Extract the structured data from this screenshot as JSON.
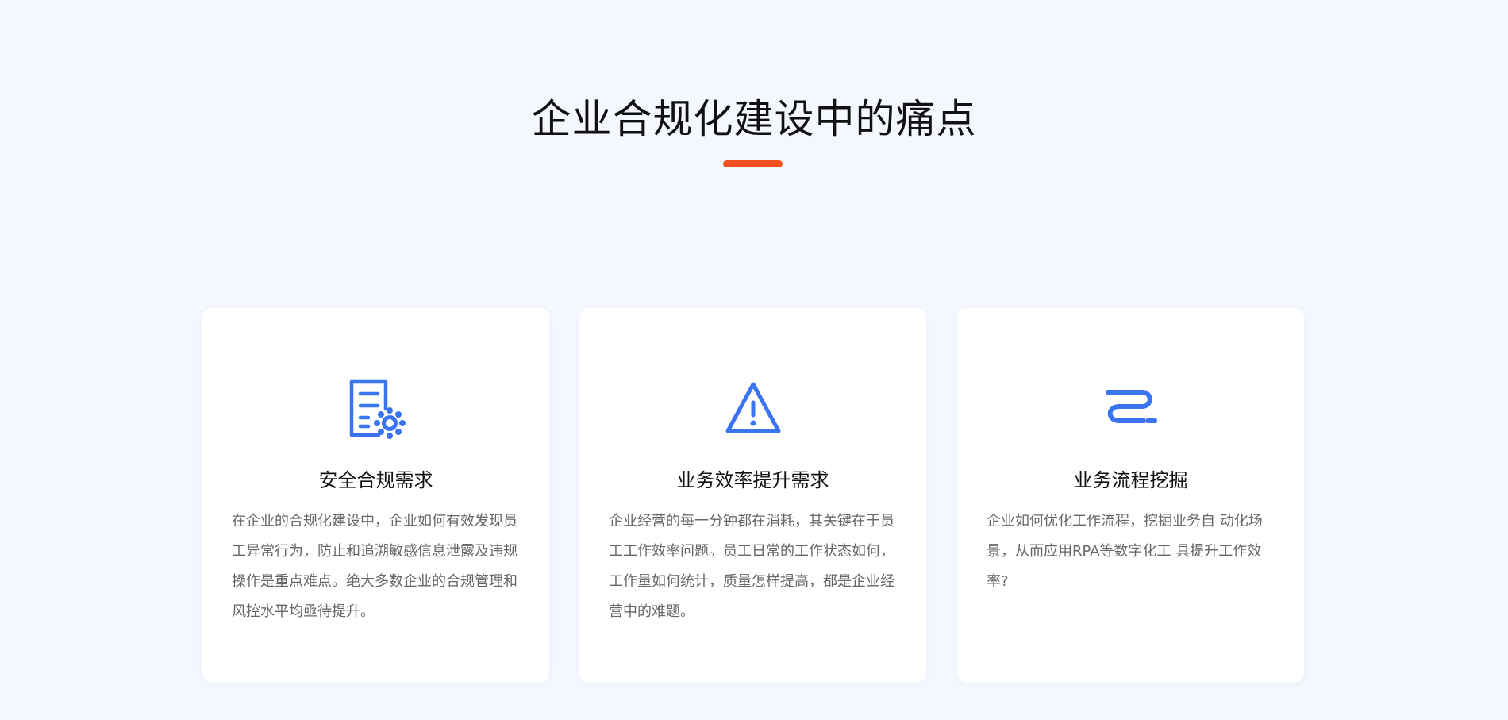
{
  "section": {
    "title": "企业合规化建设中的痛点",
    "accent_color": "#f0521f",
    "icon_color": "#3b74f0"
  },
  "cards": [
    {
      "icon": "document-settings-icon",
      "title": "安全合规需求",
      "description": "在企业的合规化建设中，企业如何有效发现员工异常行为，防止和追溯敏感信息泄露及违规操作是重点难点。绝大多数企业的合规管理和风控水平均亟待提升。"
    },
    {
      "icon": "warning-icon",
      "title": "业务效率提升需求",
      "description": "企业经营的每一分钟都在消耗，其关键在于员工工作效率问题。员工日常的工作状态如何，工作量如何统计，质量怎样提高，都是企业经营中的难题。"
    },
    {
      "icon": "process-flow-icon",
      "title": "业务流程挖掘",
      "description": "企业如何优化工作流程，挖掘业务自 动化场景，从而应用RPA等数字化工 具提升工作效率?"
    }
  ]
}
